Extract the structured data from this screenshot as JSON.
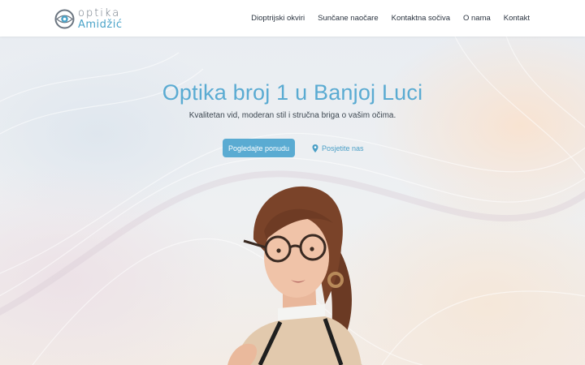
{
  "brand": {
    "line1": "optika",
    "line2": "Amidžić",
    "accent_color": "#5aabd2",
    "icon": "eye-logo-icon"
  },
  "nav": {
    "items": [
      {
        "label": "Dioptrijski okviri"
      },
      {
        "label": "Sunčane naočare"
      },
      {
        "label": "Kontaktna sočiva"
      },
      {
        "label": "O nama"
      },
      {
        "label": "Kontakt"
      }
    ]
  },
  "hero": {
    "title": "Optika broj 1 u Banjoj Luci",
    "subtitle": "Kvalitetan vid, moderan stil i stručna briga o vašim očima.",
    "primary_button": "Pogledajte ponudu",
    "secondary_link": "Posjetite nas",
    "secondary_icon": "map-pin-icon",
    "image": "woman-with-glasses-photo"
  }
}
